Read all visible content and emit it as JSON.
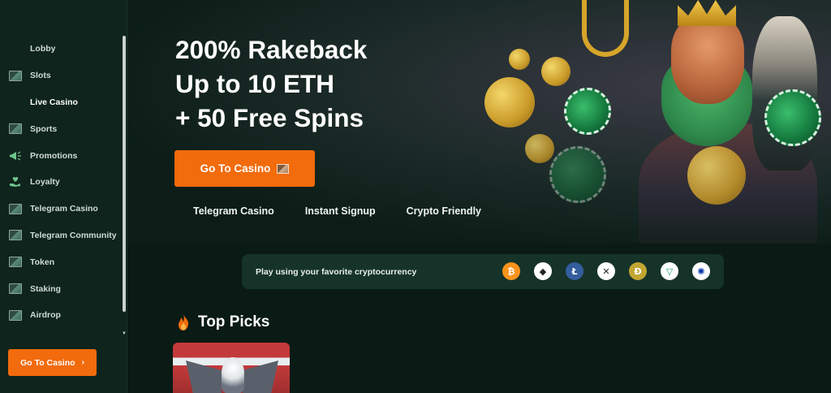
{
  "sidebar": {
    "items": [
      {
        "label": "Lobby",
        "icon": "blank"
      },
      {
        "label": "Slots",
        "icon": "image-placeholder-icon"
      },
      {
        "label": "Live Casino",
        "icon": "blank"
      },
      {
        "label": "Sports",
        "icon": "image-placeholder-icon"
      },
      {
        "label": "Promotions",
        "icon": "megaphone-icon"
      },
      {
        "label": "Loyalty",
        "icon": "heart-hand-icon"
      },
      {
        "label": "Telegram Casino",
        "icon": "image-placeholder-icon"
      },
      {
        "label": "Telegram Community",
        "icon": "image-placeholder-icon"
      },
      {
        "label": "Token",
        "icon": "image-placeholder-icon"
      },
      {
        "label": "Staking",
        "icon": "image-placeholder-icon"
      },
      {
        "label": "Airdrop",
        "icon": "image-placeholder-icon"
      }
    ],
    "cta_label": "Go To Casino",
    "cta_chevron": "›"
  },
  "hero": {
    "title_lines": [
      "200% Rakeback",
      "Up to 10 ETH",
      "+ 50 Free Spins"
    ],
    "cta_label": "Go To Casino",
    "features": [
      "Telegram Casino",
      "Instant Signup",
      "Crypto Friendly"
    ]
  },
  "crypto": {
    "label": "Play using your favorite cryptocurrency",
    "coins": [
      {
        "name": "bitcoin-icon",
        "glyph": "₿",
        "color": "#f7931a"
      },
      {
        "name": "ethereum-icon",
        "glyph": "◆",
        "color": "#ffffff"
      },
      {
        "name": "litecoin-icon",
        "glyph": "Ł",
        "color": "#345d9d"
      },
      {
        "name": "xrp-icon",
        "glyph": "✕",
        "color": "#ffffff"
      },
      {
        "name": "dogecoin-icon",
        "glyph": "Ð",
        "color": "#c2a633"
      },
      {
        "name": "tether-icon",
        "glyph": "▽",
        "color": "#ffffff"
      },
      {
        "name": "cardano-icon",
        "glyph": "✺",
        "color": "#ffffff"
      }
    ]
  },
  "top_picks": {
    "title": "Top Picks"
  },
  "colors": {
    "accent": "#f26b0c",
    "sidebar_bg": "#0f241d",
    "page_bg": "#0a1a15",
    "crypto_bar_bg": "#16332a"
  }
}
